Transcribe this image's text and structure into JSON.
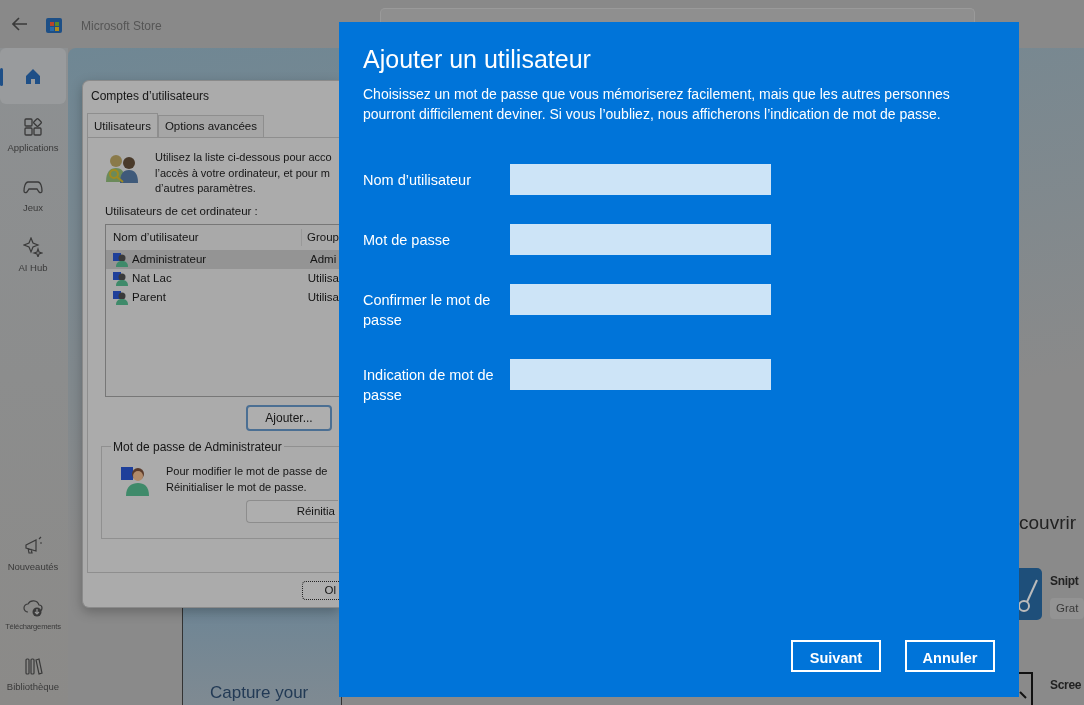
{
  "store": {
    "title": "Microsoft Store",
    "sidebar_top": [
      {
        "kind": "home",
        "selected": true
      },
      {
        "kind": "apps",
        "label": "Applications",
        "selected": false
      },
      {
        "kind": "games",
        "label": "Jeux",
        "selected": false
      },
      {
        "kind": "sparkle",
        "label": "AI Hub",
        "selected": false
      }
    ],
    "sidebar_bottom": [
      {
        "kind": "megaphone",
        "label": "Nouveautés",
        "selected": false
      },
      {
        "kind": "download",
        "label": "Téléchargements",
        "selected": false
      },
      {
        "kind": "library",
        "label": "Bibliothèque",
        "selected": false
      }
    ],
    "banner": "Capture your",
    "section_heading": "couvrir",
    "apps": [
      {
        "kind": "scissors",
        "name": "Snipt",
        "price": "Grat"
      },
      {
        "kind": "crop",
        "name": "Scree"
      }
    ]
  },
  "user_accounts_dialog": {
    "title": "Comptes d’utilisateurs",
    "tabs": [
      {
        "label": "Utilisateurs",
        "selected": true
      },
      {
        "label": "Options avancées",
        "selected": false
      }
    ],
    "intro_lines": [
      "Utilisez la liste ci-dessous pour acco",
      "l’accès à votre ordinateur, et pour m",
      "d’autres paramètres."
    ],
    "list_label": "Utilisateurs de cet ordinateur :",
    "columns": [
      "Nom d’utilisateur",
      "Group"
    ],
    "rows": [
      {
        "name": "Administrateur",
        "group": "Admi",
        "selected": true
      },
      {
        "name": "Nat Lac",
        "group": "Utilisa",
        "selected": false
      },
      {
        "name": "Parent",
        "group": "Utilisa",
        "selected": false
      }
    ],
    "add_button": "Ajouter...",
    "password_group": {
      "title": "Mot de passe de Administrateur",
      "lines": [
        "Pour modifier le mot de passe de",
        "Réinitialiser le mot de passe."
      ],
      "button": "Réinitia"
    },
    "ok_button": "Ol"
  },
  "add_user_dialog": {
    "title": "Ajouter un utilisateur",
    "description": "Choisissez un mot de passe que vous mémoriserez facilement, mais que les autres personnes pourront difficilement deviner. Si vous l’oubliez, nous afficherons l’indication de mot de passe.",
    "fields": [
      {
        "label": "Nom d’utilisateur"
      },
      {
        "label": "Mot de passe"
      },
      {
        "label": "Confirmer le mot de passe"
      },
      {
        "label": "Indication de mot de passe"
      }
    ],
    "buttons": [
      {
        "label": "Suivant"
      },
      {
        "label": "Annuler"
      }
    ]
  }
}
